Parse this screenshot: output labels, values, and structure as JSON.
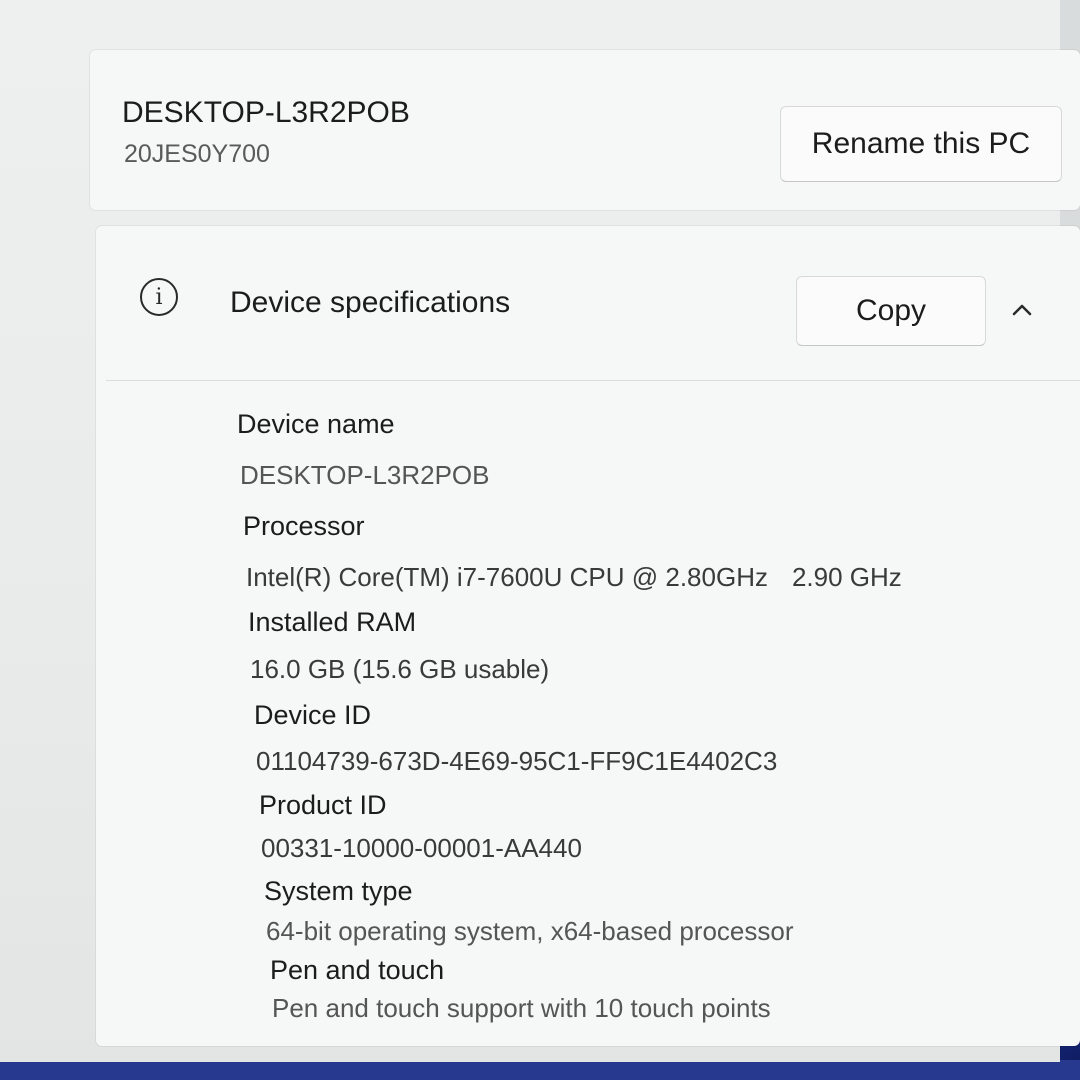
{
  "device": {
    "name": "DESKTOP-L3R2POB",
    "model": "20JES0Y700",
    "rename_label": "Rename this PC"
  },
  "specs": {
    "title": "Device specifications",
    "copy_label": "Copy",
    "info_icon": "info-icon",
    "collapse_icon": "chevron-up-icon",
    "items": [
      {
        "label": "Device name",
        "value": "DESKTOP-L3R2POB"
      },
      {
        "label": "Processor",
        "value": "Intel(R) Core(TM) i7-7600U CPU @ 2.80GHz",
        "value_extra": "2.90 GHz"
      },
      {
        "label": "Installed RAM",
        "value": "16.0 GB (15.6 GB usable)"
      },
      {
        "label": "Device ID",
        "value": "01104739-673D-4E69-95C1-FF9C1E4402C3"
      },
      {
        "label": "Product ID",
        "value": "00331-10000-00001-AA440"
      },
      {
        "label": "System type",
        "value": "64-bit operating system, x64-based processor"
      },
      {
        "label": "Pen and touch",
        "value": "Pen and touch support with 10 touch points"
      }
    ]
  }
}
